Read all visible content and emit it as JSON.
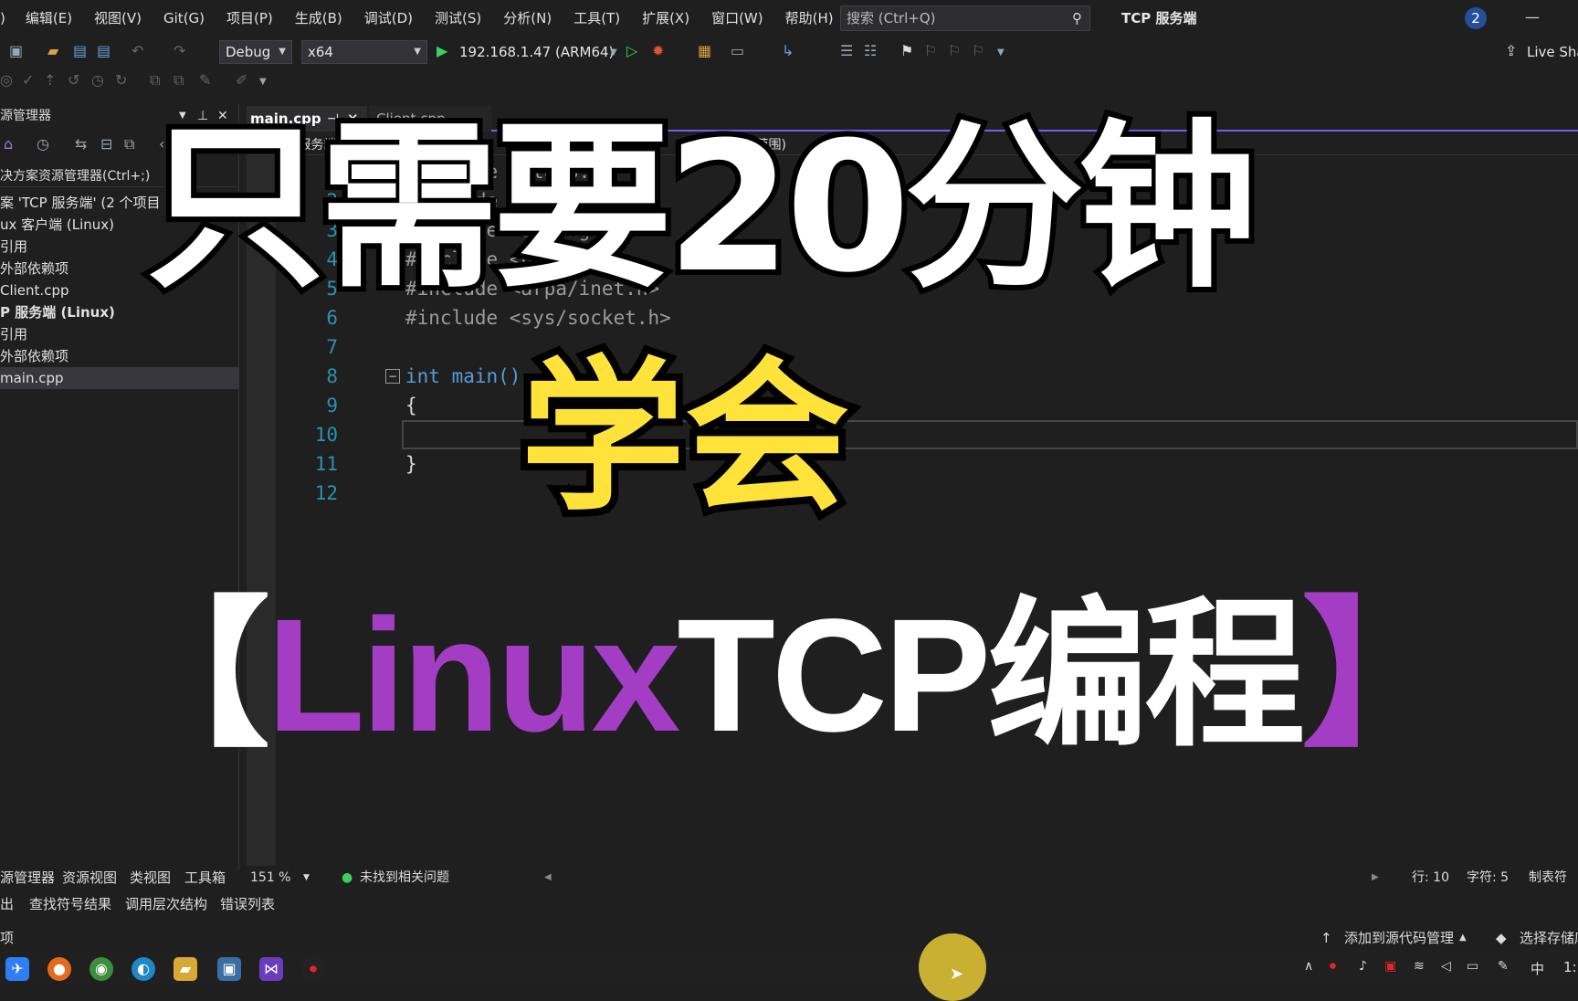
{
  "menu": {
    "items": [
      ")",
      "编辑(E)",
      "视图(V)",
      "Git(G)",
      "项目(P)",
      "生成(B)",
      "调试(D)",
      "测试(S)",
      "分析(N)",
      "工具(T)",
      "扩展(X)",
      "窗口(W)",
      "帮助(H)"
    ],
    "search_placeholder": "搜索 (Ctrl+Q)",
    "app_title": "TCP 服务端",
    "notification_count": "2",
    "minimize": "—"
  },
  "toolbar": {
    "config": "Debug",
    "platform": "x64",
    "run_target": "192.168.1.47 (ARM64)",
    "live_share": "Live Sha"
  },
  "solution_explorer": {
    "title": "源管理器",
    "search": "决方案资源管理器(Ctrl+;)",
    "items": [
      {
        "label": "案 'TCP 服务端' (2 个项目",
        "bold": false
      },
      {
        "label": "ux 客户端 (Linux)",
        "bold": false
      },
      {
        "label": "引用",
        "bold": false
      },
      {
        "label": "外部依赖项",
        "bold": false
      },
      {
        "label": "Client.cpp",
        "bold": false
      },
      {
        "label": "P 服务端 (Linux)",
        "bold": true
      },
      {
        "label": "引用",
        "bold": false
      },
      {
        "label": "外部依赖项",
        "bold": false
      },
      {
        "label": "main.cpp",
        "bold": false
      }
    ],
    "bottom_tabs": [
      "源管理器",
      "资源视图",
      "类视图",
      "工具箱"
    ]
  },
  "editor": {
    "tabs": [
      {
        "label": "main.cpp",
        "active": true
      },
      {
        "label": "Client.cpp",
        "active": false
      }
    ],
    "nav_project": "TCP 服务端",
    "nav_scope": "(全局范围)",
    "lines": [
      {
        "num": "1",
        "text": "#include <stdio.h>"
      },
      {
        "num": "2",
        "text": "#include <stdlib.h>"
      },
      {
        "num": "3",
        "text": "#include <string.h>"
      },
      {
        "num": "4",
        "text": "#include <unistd.h>"
      },
      {
        "num": "5",
        "text": "#include <arpa/inet.h>"
      },
      {
        "num": "6",
        "text": "#include <sys/socket.h>"
      },
      {
        "num": "7",
        "text": ""
      },
      {
        "num": "8",
        "text": "int main()"
      },
      {
        "num": "9",
        "text": "{"
      },
      {
        "num": "10",
        "text": ""
      },
      {
        "num": "11",
        "text": "}"
      },
      {
        "num": "12",
        "text": ""
      }
    ],
    "zoom": "151 %",
    "issues": "未找到相关问题",
    "line_pos": "行: 10",
    "col_pos": "字符: 5",
    "tab_mode": "制表符"
  },
  "output_tabs": [
    "输出",
    "查找符号结果",
    "调用层次结构",
    "错误列表"
  ],
  "status_bar": {
    "left": "项",
    "source_control": "添加到源代码管理",
    "repo": "选择存储库"
  },
  "tray": {
    "ime": "中",
    "clock": "1:"
  },
  "overlay": {
    "line1": "只需要20分钟",
    "line2": "学会",
    "bracket_open": "【",
    "linux": "Linux",
    "tcp": "TCP编程",
    "bracket_close": "】"
  },
  "colors": {
    "accent_purple": "#a23dc4",
    "overlay_yellow": "#ffe33a",
    "tab_underline": "#7160e8",
    "line_number": "#2b91af",
    "keyword": "#569cd6"
  }
}
